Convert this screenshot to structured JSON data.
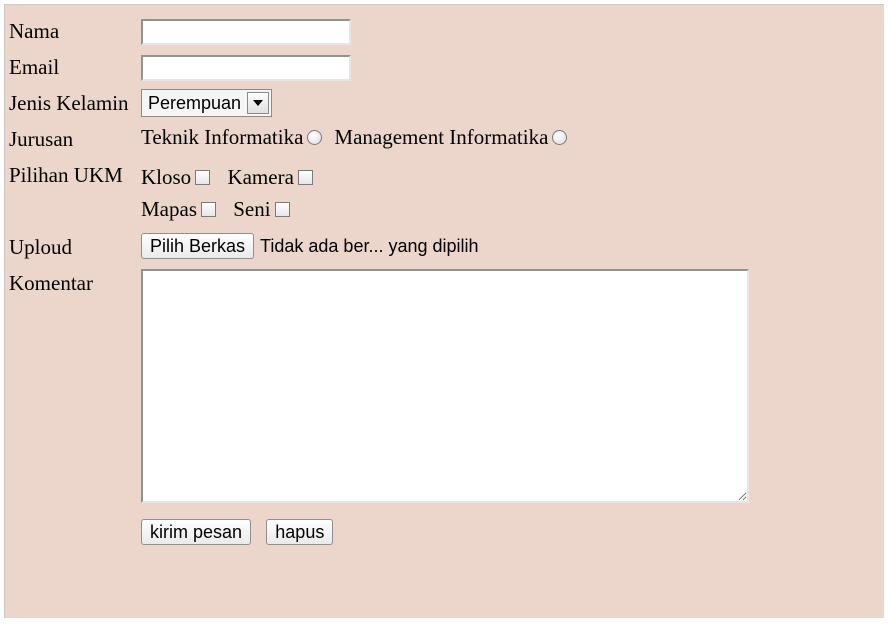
{
  "labels": {
    "nama": "Nama",
    "email": "Email",
    "jenis_kelamin": "Jenis Kelamin",
    "jurusan": "Jurusan",
    "pilihan_ukm": "Pilihan UKM",
    "uploud": "Uploud",
    "komentar": "Komentar"
  },
  "fields": {
    "nama_value": "",
    "email_value": "",
    "jenis_kelamin_selected": "Perempuan",
    "jurusan_options": {
      "teknik_informatika": "Teknik Informatika",
      "management_informatika": "Management Informatika"
    },
    "ukm_options": {
      "kloso": "Kloso",
      "kamera": "Kamera",
      "mapas": "Mapas",
      "seni": "Seni"
    },
    "file_button": "Pilih Berkas",
    "file_status": "Tidak ada ber... yang dipilih",
    "komentar_value": ""
  },
  "actions": {
    "submit": "kirim pesan",
    "reset": "hapus"
  }
}
